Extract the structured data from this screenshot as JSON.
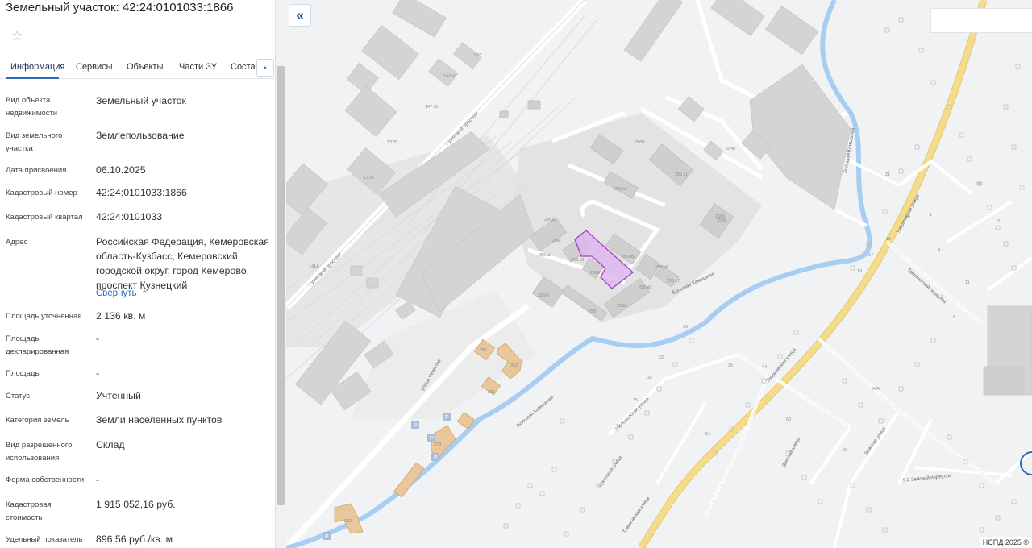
{
  "panel": {
    "title": "Земельный участок: 42:24:0101033:1866",
    "star_icon": "☆",
    "tabs": [
      "Информация",
      "Сервисы",
      "Объекты",
      "Части ЗУ",
      "Состав"
    ],
    "next_icon": "▸",
    "collapse_label": "Свернуть",
    "collapse_icon": "⌃",
    "fields": [
      {
        "label": "Вид объекта недвижимости",
        "value": "Земельный участок"
      },
      {
        "label": "Вид земельного участка",
        "value": "Землепользование"
      },
      {
        "label": "Дата присвоения",
        "value": "06.10.2025"
      },
      {
        "label": "Кадастровый номер",
        "value": "42:24:0101033:1866"
      },
      {
        "label": "Кадастровый квартал",
        "value": "42:24:0101033"
      },
      {
        "label": "Адрес",
        "value": "Российская Федерация, Кемеровская область-Кузбасс, Кемеровский городской округ, город Кемерово, проспект Кузнецкий"
      },
      {
        "label": "Площадь уточненная",
        "value": "2 136 кв. м"
      },
      {
        "label": "Площадь декларированная",
        "value": "-"
      },
      {
        "label": "Площадь",
        "value": "-"
      },
      {
        "label": "Статус",
        "value": "Учтенный"
      },
      {
        "label": "Категория земель",
        "value": "Земли населенных пунктов"
      },
      {
        "label": "Вид разрешенного использования",
        "value": "Склад"
      },
      {
        "label": "Форма собственности",
        "value": "-"
      },
      {
        "label": "Кадастровая стоимость",
        "value": "1 915 052,16 руб."
      },
      {
        "label": "Удельный показатель",
        "value": "896,56 руб./кв. м"
      }
    ]
  },
  "map": {
    "collapse_icon": "«",
    "attribution": "НСПД 2025 ©",
    "colors": {
      "background": "#f1f2f3",
      "building": "#d4d4d4",
      "building_dark": "#c9c9c9",
      "industrial_area": "#e3e3e3",
      "river": "#a8cdf2",
      "main_road": "#f3dc8c",
      "parcel": "#a640c9",
      "parcel_fill": "#dcb4ee",
      "highlight_building": "#e8c79a"
    },
    "streets": [
      "Кузнецкий проспект",
      "Кузнецкий проспект",
      "Таврическая улица",
      "Таврическая улица",
      "Таврическая улица",
      "Таврический переулок",
      "2-я Чукотская улица",
      "Чукотская улица",
      "Донская улица",
      "Зейская улица",
      "3-й Зейский переулок",
      "улица Чекистов",
      "Большая Камышная",
      "Большая Камышная",
      "Большая Камышная"
    ],
    "building_numbers": [
      "137",
      "147 к3",
      "147 к5",
      "137Б",
      "137А",
      "141А",
      "256В",
      "256 к1",
      "256 к4",
      "256Б",
      "256Д",
      "256Г",
      "256 к2",
      "256 к3",
      "256 к5",
      "256Е",
      "256 к6",
      "256 к7",
      "256 к8",
      "256Ж",
      "256А",
      "2548",
      "256",
      "2566",
      "261",
      "263",
      "265",
      "279",
      "292",
      "7",
      "8",
      "15",
      "17",
      "19",
      "21",
      "22",
      "30",
      "32",
      "35",
      "36",
      "44",
      "45",
      "52",
      "54",
      "60",
      "64А",
      "66",
      "1",
      "4",
      "11",
      "20",
      "31"
    ]
  }
}
